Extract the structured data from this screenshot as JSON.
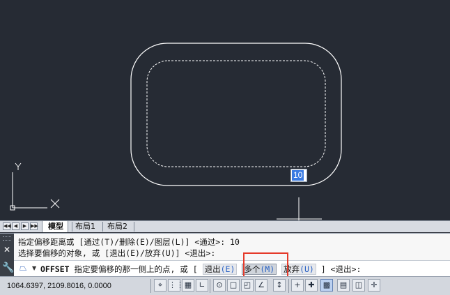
{
  "drawing": {
    "dynamic_input_value": "10",
    "ucs_y_label": "Y",
    "ucs_x_label": "X"
  },
  "layout_tabs": {
    "nav_buttons": [
      "◀◀",
      "◀",
      "▶",
      "▶▶"
    ],
    "tabs": [
      "模型",
      "布局1",
      "布局2"
    ],
    "active_tab": "模型"
  },
  "command": {
    "history": [
      "指定偏移距离或 [通过(T)/删除(E)/图层(L)] <通过>: 10",
      "选择要偏移的对象, 或 [退出(E)/放弃(U)] <退出>:"
    ],
    "command_name": "OFFSET",
    "prompt": "指定要偏移的那一侧上的点, 或 [",
    "options": [
      {
        "label": "退出",
        "key": "(E)"
      },
      {
        "label": "多个",
        "key": "(M)"
      },
      {
        "label": "放弃",
        "key": "(U)"
      }
    ],
    "suffix": "] <退出>:",
    "highlighted_option": "多个(M)"
  },
  "status_bar": {
    "coordinates": "1064.6397, 2109.8016, 0.0000",
    "buttons": [
      {
        "name": "infer-constraints",
        "glyph": "⌖",
        "on": false
      },
      {
        "name": "snap-mode",
        "glyph": "⋮⋮",
        "on": false
      },
      {
        "name": "grid-display",
        "glyph": "▦",
        "on": false
      },
      {
        "name": "ortho-mode",
        "glyph": "∟",
        "on": false
      },
      {
        "name": "polar-tracking",
        "glyph": "⊙",
        "on": false
      },
      {
        "name": "object-snap",
        "glyph": "□",
        "on": false
      },
      {
        "name": "3d-object-snap",
        "glyph": "◰",
        "on": false
      },
      {
        "name": "object-snap-tracking",
        "glyph": "∠",
        "on": false
      },
      {
        "name": "dynamic-ucs",
        "glyph": "↕",
        "on": false
      },
      {
        "name": "dynamic-input",
        "glyph": "+",
        "on": false
      },
      {
        "name": "show-lineweight",
        "glyph": "✚",
        "on": false
      },
      {
        "name": "transparency",
        "glyph": "▩",
        "on": true
      },
      {
        "name": "quick-properties",
        "glyph": "▤",
        "on": false
      },
      {
        "name": "selection-cycling",
        "glyph": "◫",
        "on": false
      },
      {
        "name": "annotation-monitor",
        "glyph": "✛",
        "on": false
      }
    ]
  },
  "colors": {
    "canvas_bg": "#262b34",
    "highlight_box": "#e53a2a",
    "arrow": "#e53a2a",
    "dynamic_input_selection": "#3b7be2"
  }
}
